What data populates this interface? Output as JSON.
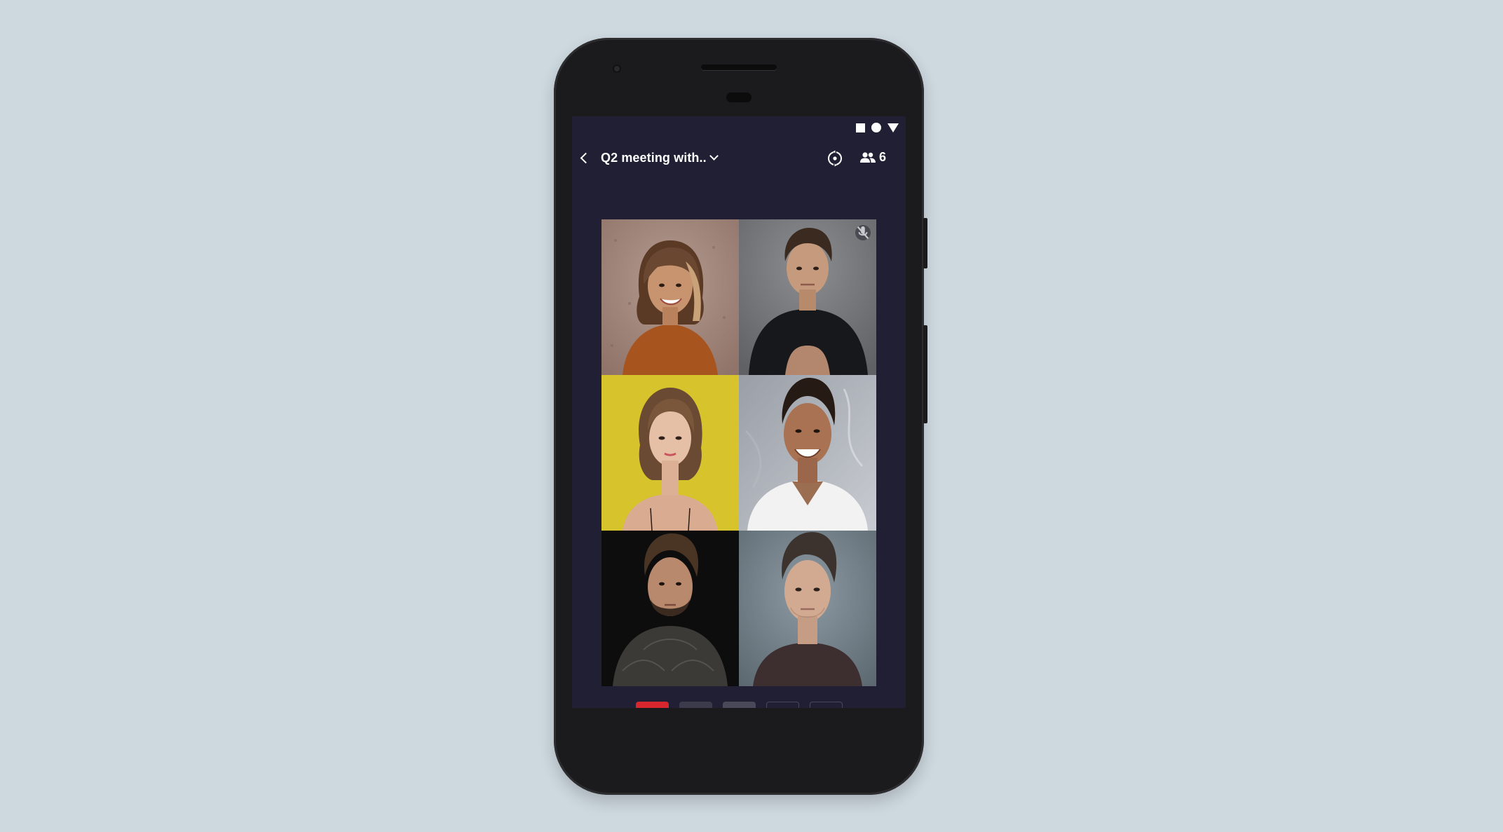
{
  "meeting": {
    "title": "Q2 meeting with..",
    "participant_count": "6"
  },
  "colors": {
    "background": "#cdd8df",
    "screen": "#211f33",
    "hangup": "#d7262d",
    "control": "#4a4959"
  },
  "icons": {
    "back": "back-icon",
    "title_dropdown": "chevron-down-icon",
    "camera_switch": "camera-switch-icon",
    "participants": "people-icon",
    "hangup": "phone-hangup-icon",
    "mic": "microphone-icon",
    "video": "video-camera-icon",
    "chat": "chat-icon",
    "more": "more-horizontal-icon",
    "muted": "mic-off-icon"
  },
  "participants": [
    {
      "tile": 1,
      "muted": false
    },
    {
      "tile": 2,
      "muted": true
    },
    {
      "tile": 3,
      "muted": false
    },
    {
      "tile": 4,
      "muted": false
    },
    {
      "tile": 5,
      "muted": false
    },
    {
      "tile": 6,
      "muted": false
    }
  ]
}
